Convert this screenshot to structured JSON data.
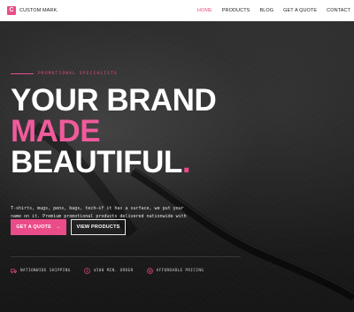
{
  "nav": {
    "logo_mark": "C",
    "logo_text": "CUSTOM MARK.",
    "items": [
      {
        "label": "HOME",
        "active": true
      },
      {
        "label": "PRODUCTS"
      },
      {
        "label": "BLOG"
      },
      {
        "label": "GET A QUOTE"
      },
      {
        "label": "CONTACT"
      }
    ]
  },
  "hero": {
    "eyebrow": "PROMOTIONAL SPECIALISTS",
    "headline_line1": "YOUR BRAND",
    "headline_line2": "MADE",
    "headline_line3": "BEAUTIFUL",
    "headline_dot": ".",
    "subtext": "T-shirts, mugs, pens, bags, tech—if it has a surface, we put your name on it. Premium promotional products delivered nationwide with unbeatable pricing.",
    "primary_button": "GET A QUOTE",
    "primary_button_arrow": "→",
    "secondary_button": "VIEW PRODUCTS"
  },
  "features": [
    {
      "icon": "truck-icon",
      "label": "NATIONWIDE SHIPPING"
    },
    {
      "icon": "dollar-icon",
      "label": "$500 MIN. ORDER"
    },
    {
      "icon": "tag-icon",
      "label": "AFFORDABLE PRICING"
    }
  ],
  "colors": {
    "accent": "#ea4c89",
    "headline_pink": "#f05b9c",
    "nav_bg": "#ffffff",
    "hero_bg": "#1e1e1f"
  }
}
